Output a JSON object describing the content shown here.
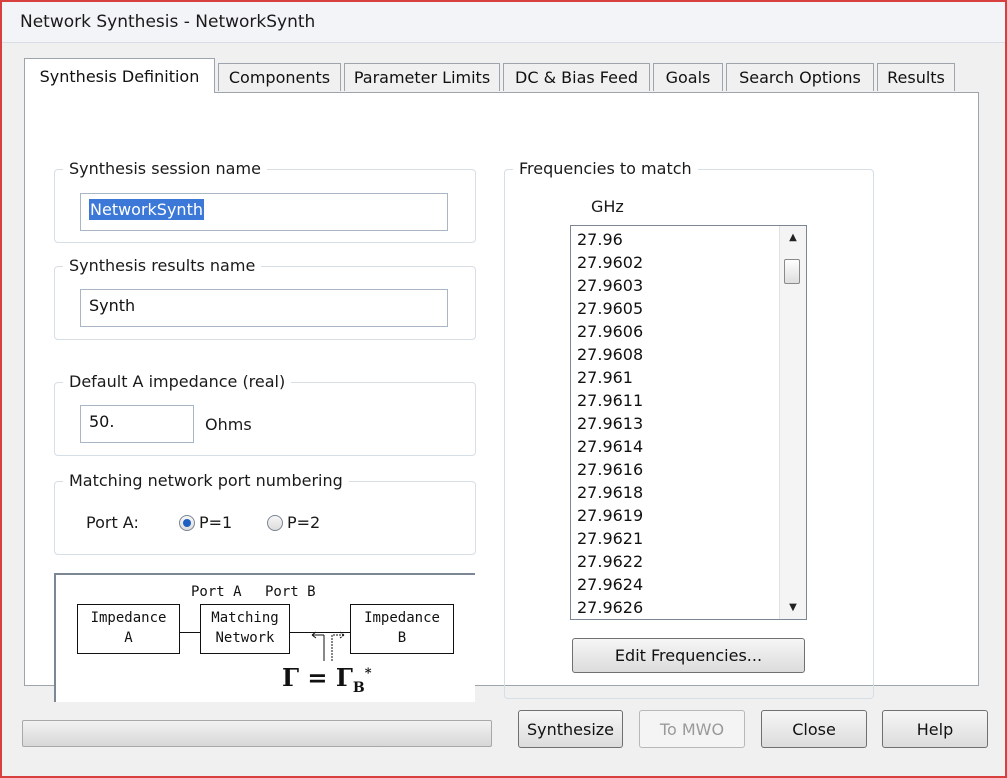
{
  "window": {
    "title": "Network Synthesis - NetworkSynth"
  },
  "tabs": [
    {
      "label": "Synthesis Definition",
      "active": true
    },
    {
      "label": "Components",
      "active": false
    },
    {
      "label": "Parameter Limits",
      "active": false
    },
    {
      "label": "DC & Bias Feed",
      "active": false
    },
    {
      "label": "Goals",
      "active": false
    },
    {
      "label": "Search Options",
      "active": false
    },
    {
      "label": "Results",
      "active": false
    }
  ],
  "session": {
    "legend": "Synthesis session name",
    "value": "NetworkSynth"
  },
  "results": {
    "legend": "Synthesis results name",
    "value": "Synth"
  },
  "impedance": {
    "legend": "Default A impedance (real)",
    "value": "50.",
    "unit": "Ohms"
  },
  "ports": {
    "legend": "Matching network port numbering",
    "label": "Port A:",
    "options": [
      {
        "label": "P=1",
        "checked": true
      },
      {
        "label": "P=2",
        "checked": false
      }
    ]
  },
  "diagram": {
    "port_a": "Port A",
    "port_b": "Port B",
    "impedance_a_line1": "Impedance",
    "impedance_a_line2": "A",
    "network_line1": "Matching",
    "network_line2": "Network",
    "impedance_b_line1": "Impedance",
    "impedance_b_line2": "B",
    "equation": "Γ = Γ",
    "equation_sub": "B",
    "equation_sup": "*"
  },
  "frequencies": {
    "legend": "Frequencies to match",
    "unit": "GHz",
    "items": [
      "27.96",
      "27.9602",
      "27.9603",
      "27.9605",
      "27.9606",
      "27.9608",
      "27.961",
      "27.9611",
      "27.9613",
      "27.9614",
      "27.9616",
      "27.9618",
      "27.9619",
      "27.9621",
      "27.9622",
      "27.9624",
      "27.9626"
    ],
    "edit_button": "Edit Frequencies..."
  },
  "progress": {
    "value": 0
  },
  "buttons": {
    "synthesize": "Synthesize",
    "to_mwo": "To MWO",
    "close": "Close",
    "help": "Help"
  },
  "colors": {
    "accent": "#d84040",
    "selection": "#3b78d7",
    "radio_dot": "#1e5fc2"
  }
}
